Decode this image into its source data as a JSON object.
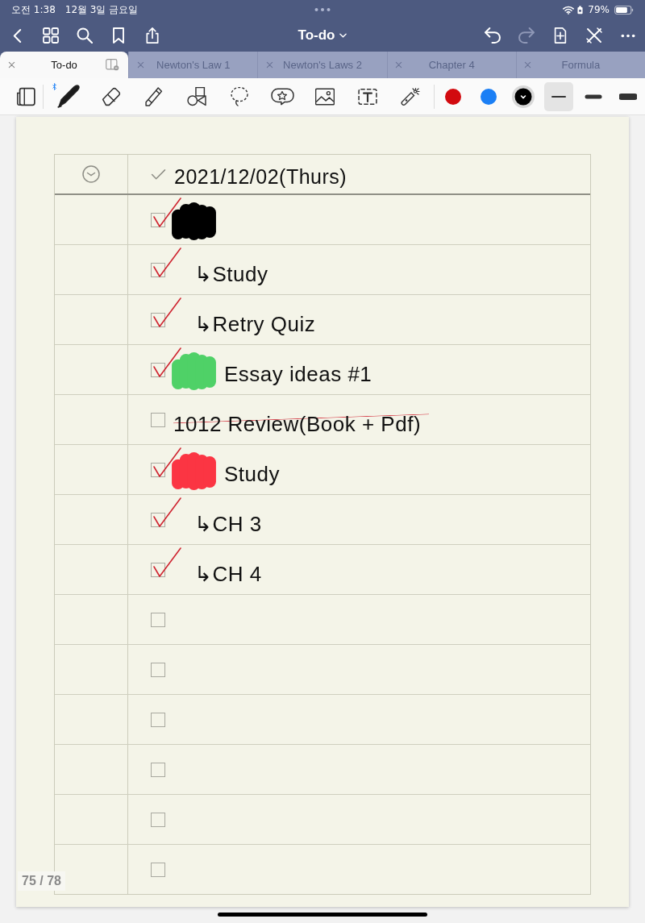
{
  "status_bar": {
    "time": "오전 1:38",
    "date": "12월 3일 금요일",
    "battery": "79%"
  },
  "nav_bar": {
    "title": "To-do",
    "undo": {
      "disabled": false
    },
    "redo": {
      "disabled": true
    }
  },
  "tabs": [
    {
      "label": "To-do",
      "selected": true
    },
    {
      "label": "Newton's Law 1",
      "selected": false
    },
    {
      "label": "Newton's Laws 2",
      "selected": false
    },
    {
      "label": "Chapter 4",
      "selected": false
    },
    {
      "label": "Formula",
      "selected": false
    }
  ],
  "toolbar": {
    "tools": [
      {
        "kind": "pen",
        "selected": true
      },
      {
        "kind": "eraser",
        "selected": false
      },
      {
        "kind": "highlighter",
        "selected": false
      },
      {
        "kind": "shapes",
        "selected": false
      },
      {
        "kind": "lasso",
        "selected": false
      },
      {
        "kind": "sticker",
        "selected": false
      },
      {
        "kind": "image",
        "selected": false
      },
      {
        "kind": "text",
        "selected": false
      },
      {
        "kind": "laser",
        "selected": false
      }
    ],
    "colors": [
      {
        "color": "#d20a0f",
        "selected": false
      },
      {
        "color": "#1b7ff5",
        "selected": false
      },
      {
        "color": "#000000",
        "selected": true
      }
    ],
    "widths": [
      {
        "kind": "thin",
        "selected": true
      },
      {
        "kind": "medium",
        "selected": false
      },
      {
        "kind": "thick",
        "selected": false
      }
    ]
  },
  "page": {
    "date": "2021/12/02(Thurs)",
    "rows": [
      {
        "checked": true,
        "color": "#000000",
        "children": [
          {
            "text": "↳Study",
            "checked": true,
            "struck": false
          },
          {
            "text": "↳Retry Quiz",
            "checked": true,
            "struck": false
          }
        ]
      },
      {
        "text": "Essay ideas #1",
        "checked": true,
        "struck": false,
        "color": "#4fd167"
      },
      {
        "text": "1012 Review(Book + Pdf)",
        "checked": false,
        "struck": true
      },
      {
        "text": "Study",
        "checked": true,
        "struck": false,
        "color": "#fb3543",
        "children": [
          {
            "text": "↳CH 3",
            "checked": true,
            "struck": false
          },
          {
            "text": "↳CH 4",
            "checked": true,
            "struck": false
          }
        ]
      },
      {
        "checked": false
      },
      {
        "checked": false
      },
      {
        "checked": false
      },
      {
        "checked": false
      },
      {
        "checked": false
      },
      {
        "checked": false
      }
    ]
  },
  "page_indicator": "75 / 78"
}
